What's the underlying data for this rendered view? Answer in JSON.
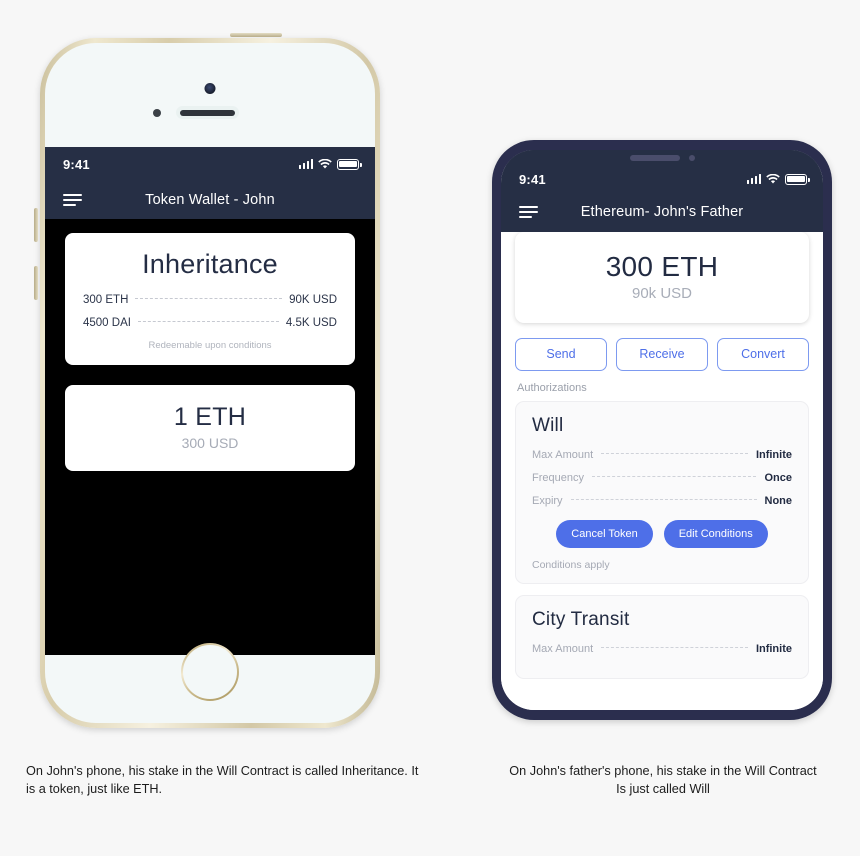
{
  "left_phone": {
    "status_bar": {
      "time": "9:41",
      "icons": [
        "signal-icon",
        "wifi-icon",
        "battery-icon"
      ]
    },
    "nav": {
      "menu_icon": "hamburger-menu-icon",
      "title": "Token Wallet - John"
    },
    "inheritance_card": {
      "title": "Inheritance",
      "rows": [
        {
          "key": "300 ETH",
          "value": "90K USD"
        },
        {
          "key": "4500 DAI",
          "value": "4.5K USD"
        }
      ],
      "note": "Redeemable upon conditions"
    },
    "eth_card": {
      "amount": "1 ETH",
      "usd": "300 USD"
    }
  },
  "right_phone": {
    "status_bar": {
      "time": "9:41",
      "icons": [
        "signal-icon",
        "wifi-icon",
        "battery-icon"
      ]
    },
    "nav": {
      "menu_icon": "hamburger-menu-icon",
      "title": "Ethereum- John's Father"
    },
    "balance_card": {
      "amount": "300 ETH",
      "usd": "90k USD"
    },
    "actions": [
      {
        "label": "Send"
      },
      {
        "label": "Receive"
      },
      {
        "label": "Convert"
      }
    ],
    "section_label": "Authorizations",
    "authorizations": [
      {
        "title": "Will",
        "rows": [
          {
            "key": "Max Amount",
            "value": "Infinite"
          },
          {
            "key": "Frequency",
            "value": "Once"
          },
          {
            "key": "Expiry",
            "value": "None"
          }
        ],
        "buttons": [
          {
            "label": "Cancel Token"
          },
          {
            "label": "Edit Conditions"
          }
        ],
        "note": "Conditions apply"
      },
      {
        "title": "City Transit",
        "rows": [
          {
            "key": "Max Amount",
            "value": "Infinite"
          }
        ]
      }
    ]
  },
  "captions": {
    "left": "On John's phone, his stake in the Will Contract is called Inheritance. It is a token, just like ETH.",
    "right": "On John's father's phone, his stake in the Will Contract Is just called Will"
  },
  "colors": {
    "header_navy": "#262F45",
    "accent_blue": "#4E6FE8",
    "accent_blue_border": "#7D9AF0",
    "text_dark": "#222B42",
    "text_muted": "#A5A9B4",
    "page_bg": "#F7F7F7",
    "right_frame": "#2B2E4E",
    "left_frame_gold": "#D8CDAB"
  }
}
